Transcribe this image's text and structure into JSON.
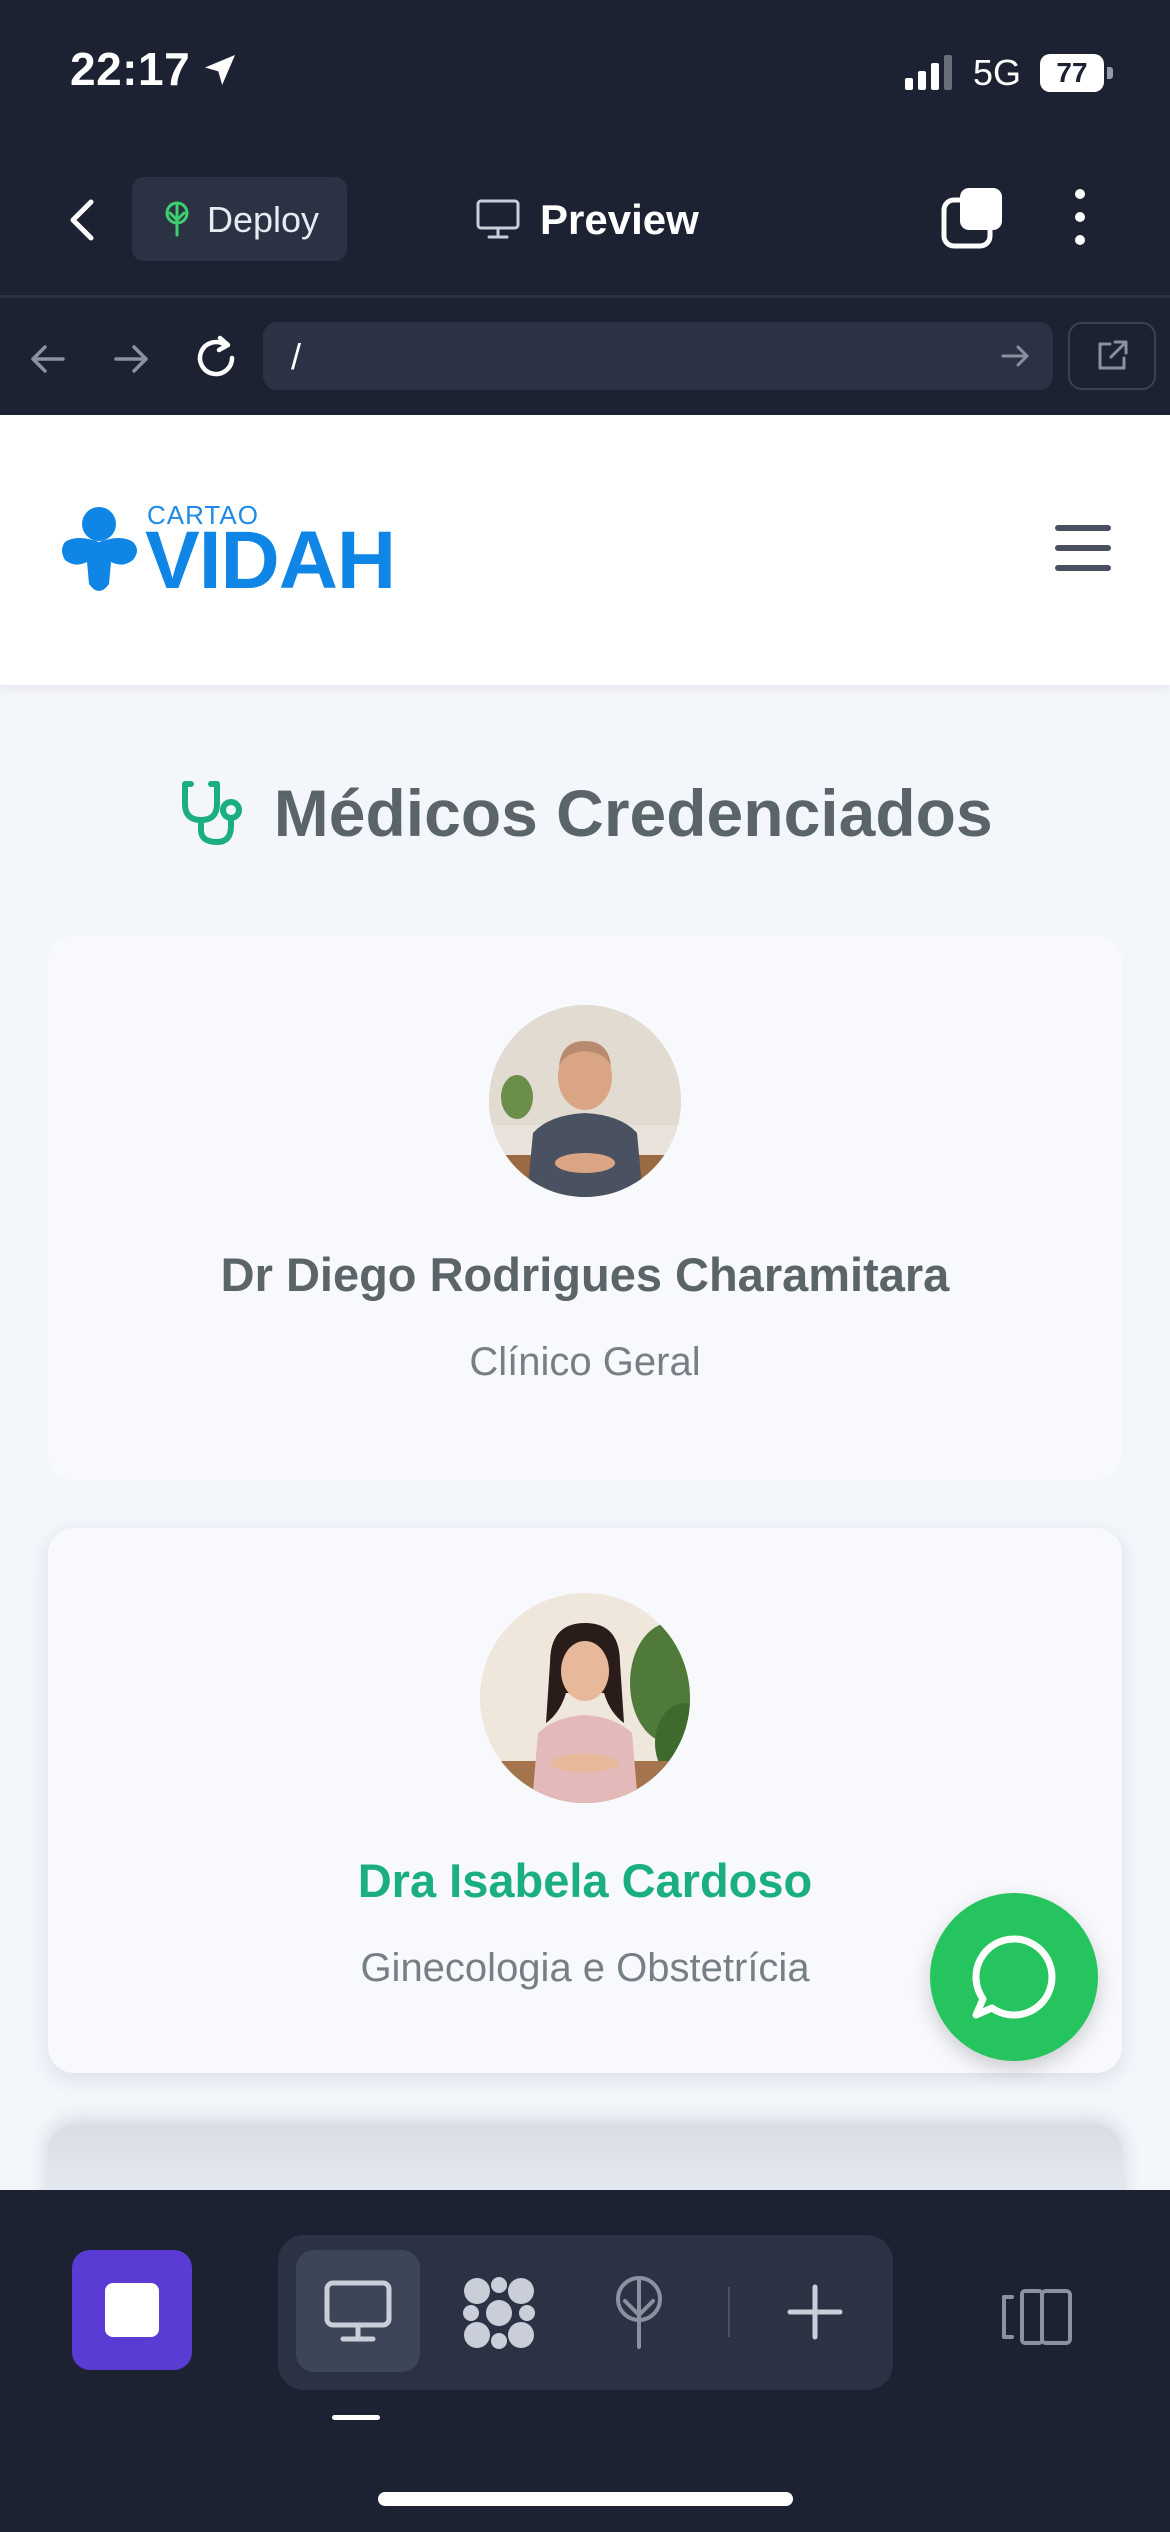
{
  "status_bar": {
    "time": "22:17",
    "network": "5G",
    "battery": "77"
  },
  "app_bar": {
    "deploy_label": "Deploy",
    "preview_label": "Preview"
  },
  "browser": {
    "url": "/"
  },
  "site": {
    "logo_small": "CARTAO",
    "logo_big": "VIDAH",
    "section_title": "Médicos Credenciados",
    "doctors": [
      {
        "name": "Dr Diego Rodrigues Charamitara",
        "specialty": "Clínico Geral"
      },
      {
        "name": "Dra Isabela Cardoso",
        "specialty": "Ginecologia e Obstetrícia"
      }
    ]
  },
  "colors": {
    "brand_blue": "#0f86e6",
    "accent_green": "#1aae82",
    "whatsapp_green": "#25c45e",
    "app_dark": "#1c2232",
    "stop_purple": "#5a3bd4"
  },
  "icons": {
    "location": "location-arrow-icon",
    "deploy": "deploy-tree-icon",
    "preview": "monitor-icon",
    "section": "stethoscope-icon",
    "chat": "whatsapp-icon"
  }
}
